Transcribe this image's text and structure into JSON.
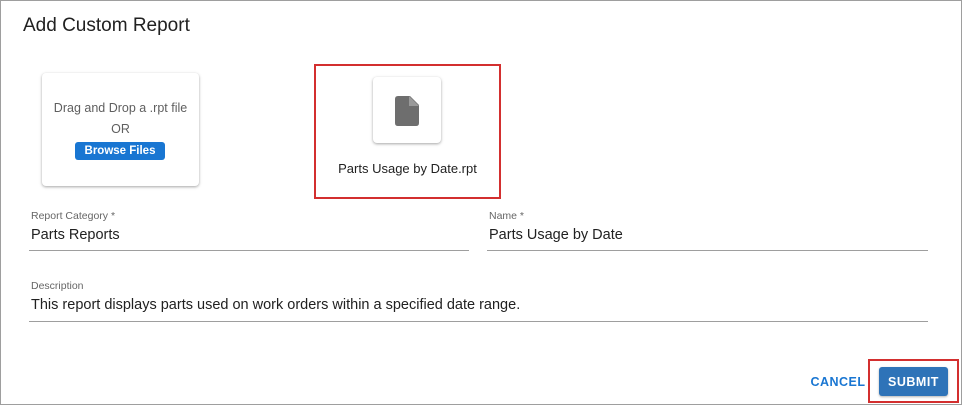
{
  "dialog": {
    "title": "Add Custom Report"
  },
  "upload": {
    "instruction": "Drag and Drop a .rpt file",
    "or_text": "OR",
    "browse_label": "Browse Files"
  },
  "file": {
    "icon": "file-icon",
    "name": "Parts Usage by Date.rpt"
  },
  "form": {
    "category": {
      "label": "Report Category *",
      "value": "Parts Reports"
    },
    "name": {
      "label": "Name *",
      "value": "Parts Usage by Date"
    },
    "description": {
      "label": "Description",
      "value": "This report displays parts used on work orders within a specified date range."
    }
  },
  "actions": {
    "cancel_label": "CANCEL",
    "submit_label": "SUBMIT"
  },
  "colors": {
    "primary": "#1976d2",
    "highlight": "#d32f2f"
  }
}
